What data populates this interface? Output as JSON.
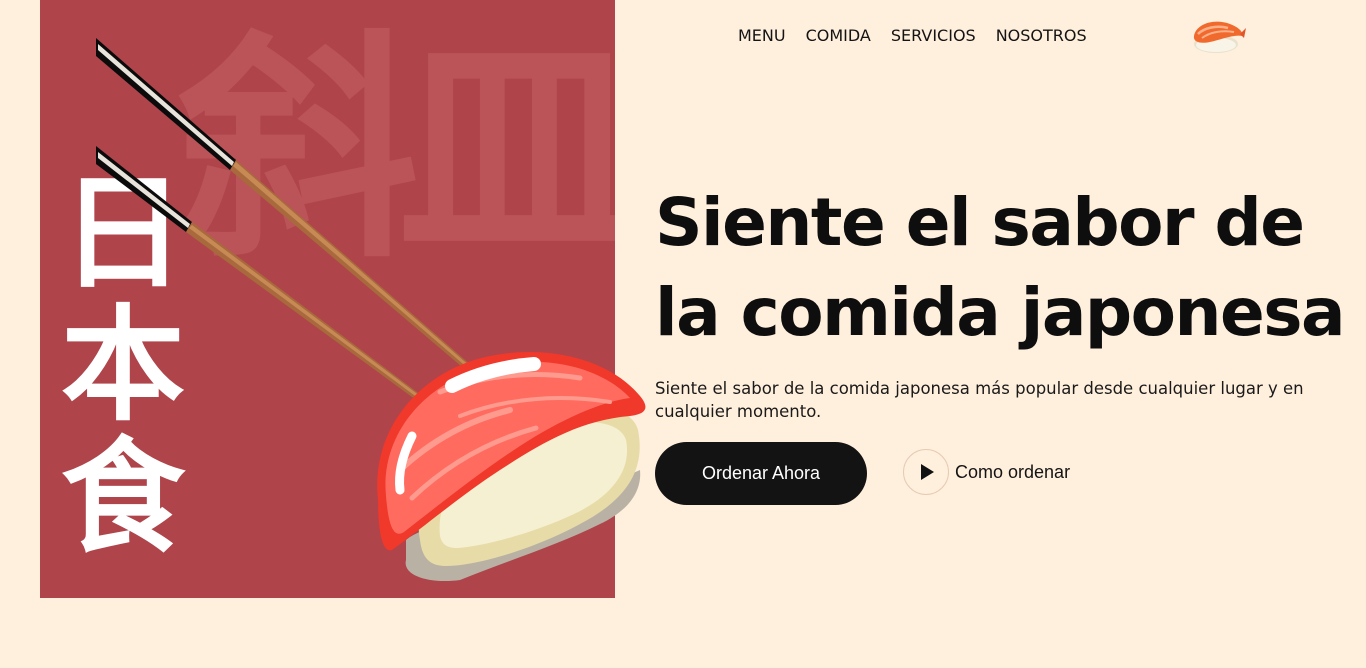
{
  "nav": {
    "items": [
      {
        "label": "MENU"
      },
      {
        "label": "COMIDA"
      },
      {
        "label": "SERVICIOS"
      },
      {
        "label": "NOSOTROS"
      }
    ],
    "logo_icon": "nigiri-sushi-icon"
  },
  "hero": {
    "background_kanji": "斜皿",
    "vertical_kanji": [
      "日",
      "本",
      "食"
    ],
    "title": "Siente el sabor de la comida japonesa",
    "subtitle": "Siente el sabor de la comida japonesa más popular desde cualquier lugar y en cualquier momento.",
    "cta_label": "Ordenar Ahora",
    "secondary_label": "Como ordenar",
    "secondary_icon": "play-icon"
  },
  "colors": {
    "background": "#FFEFDD",
    "panel": "#AF444B",
    "cta": "#131313"
  }
}
